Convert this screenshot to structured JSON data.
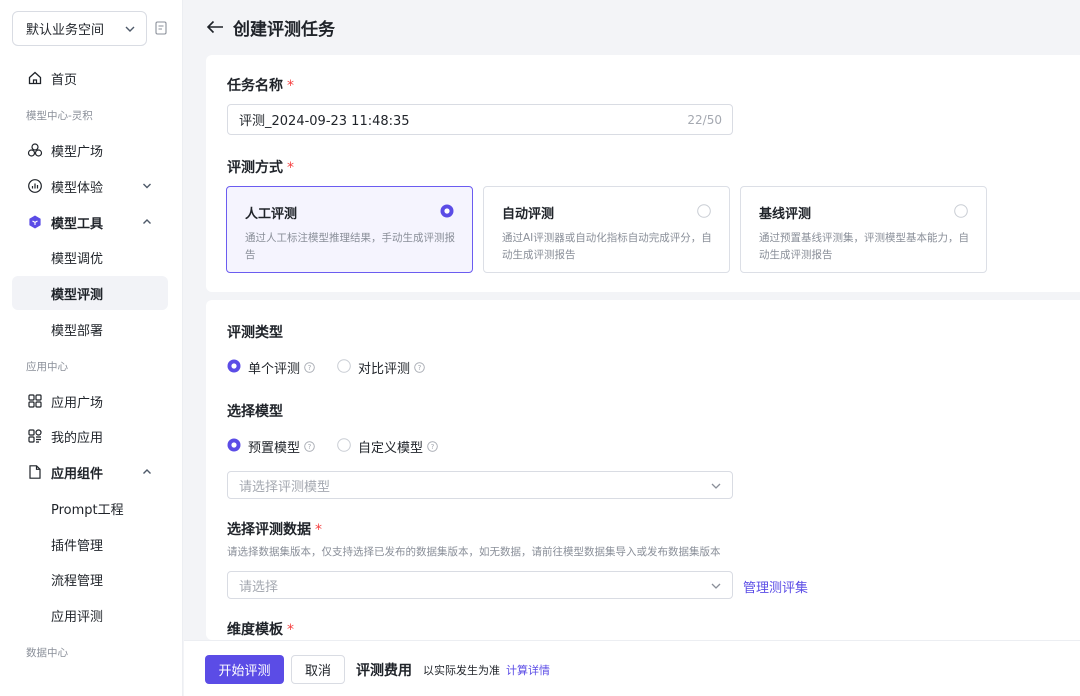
{
  "workspace": {
    "label": "默认业务空间"
  },
  "sidebar": {
    "home": "首页",
    "section_model_center": "模型中心-灵积",
    "model_plaza": "模型广场",
    "model_experience": "模型体验",
    "model_tools": "模型工具",
    "model_tuning": "模型调优",
    "model_eval": "模型评测",
    "model_deploy": "模型部署",
    "section_app_center": "应用中心",
    "app_plaza": "应用广场",
    "my_apps": "我的应用",
    "app_components": "应用组件",
    "prompt_eng": "Prompt工程",
    "plugin_mgmt": "插件管理",
    "flow_mgmt": "流程管理",
    "app_eval": "应用评测",
    "section_data_center": "数据中心"
  },
  "header": {
    "title": "创建评测任务"
  },
  "form": {
    "task_name_label": "任务名称",
    "task_name_value": "评测_2024-09-23 11:48:35",
    "task_name_count": "22/50",
    "method_label": "评测方式",
    "methods": [
      {
        "title": "人工评测",
        "desc": "通过人工标注模型推理结果，手动生成评测报告",
        "selected": true
      },
      {
        "title": "自动评测",
        "desc": "通过AI评测器或自动化指标自动完成评分，自动生成评测报告",
        "selected": false
      },
      {
        "title": "基线评测",
        "desc": "通过预置基线评测集，评测模型基本能力，自动生成评测报告",
        "selected": false
      }
    ],
    "eval_type_label": "评测类型",
    "eval_type_options": [
      "单个评测",
      "对比评测"
    ],
    "select_model_label": "选择模型",
    "model_options": [
      "预置模型",
      "自定义模型"
    ],
    "model_placeholder": "请选择评测模型",
    "dataset_label": "选择评测数据",
    "dataset_hint": "请选择数据集版本，仅支持选择已发布的数据集版本，如无数据，请前往模型数据集导入或发布数据集版本",
    "dataset_placeholder": "请选择",
    "manage_link": "管理测评集",
    "dimension_label": "维度模板"
  },
  "footer": {
    "start_button": "开始评测",
    "cancel_button": "取消",
    "fee_label": "评测费用",
    "fee_note": "以实际发生为准",
    "fee_link": "计算详情"
  },
  "colors": {
    "accent": "#5b4ce6",
    "required": "#f53f3f"
  }
}
